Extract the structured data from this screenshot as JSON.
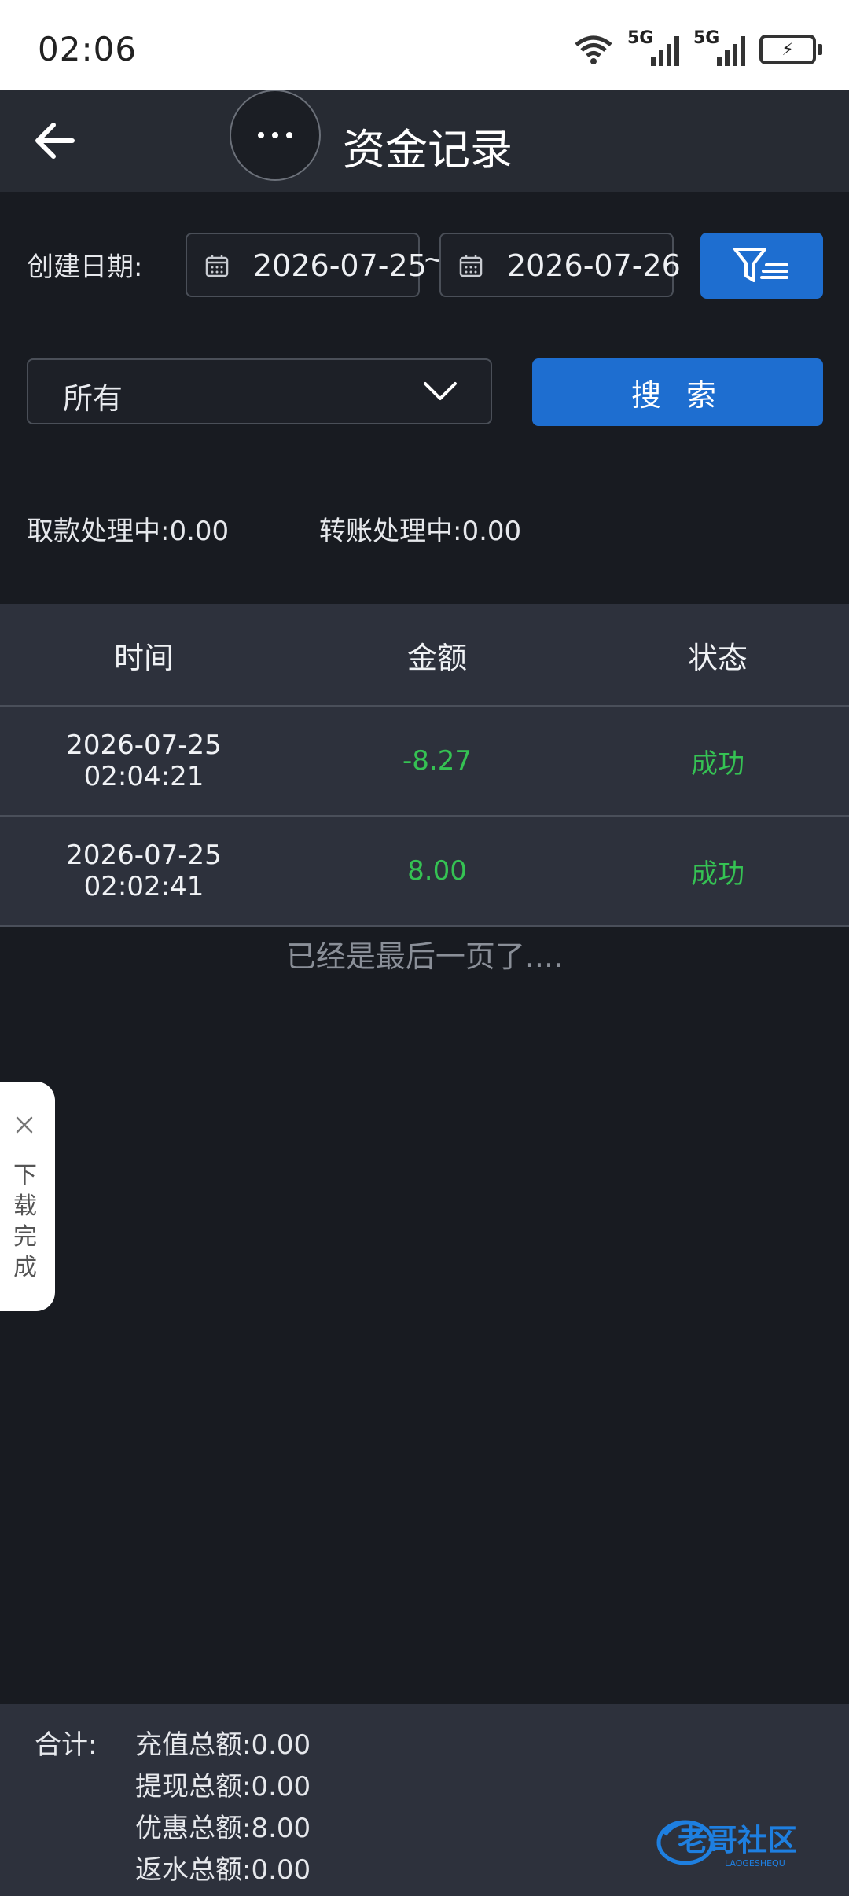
{
  "status_bar": {
    "time": "02:06",
    "network_label_1": "5G",
    "network_label_2": "5G",
    "icons": [
      "wifi-icon",
      "signal-icon",
      "signal-icon",
      "battery-charging-icon"
    ]
  },
  "header": {
    "title": "资金记录",
    "icons": [
      "back-arrow-icon",
      "more-icon"
    ]
  },
  "filters": {
    "date_label": "创建日期:",
    "start_date": "2026-07-25",
    "separator": "~",
    "end_date": "2026-07-26",
    "type_select": "所有",
    "search_label": "搜 索",
    "icons": [
      "calendar-icon",
      "filter-icon",
      "chevron-down-icon"
    ]
  },
  "pending": {
    "withdraw_label": "取款处理中:",
    "withdraw_value": "0.00",
    "transfer_label": "转账处理中:",
    "transfer_value": "0.00"
  },
  "table": {
    "headers": [
      "时间",
      "金额",
      "状态"
    ],
    "rows": [
      {
        "date": "2026-07-25",
        "time": "02:04:21",
        "amount": "-8.27",
        "status": "成功"
      },
      {
        "date": "2026-07-25",
        "time": "02:02:41",
        "amount": "8.00",
        "status": "成功"
      }
    ],
    "end_text": "已经是最后一页了...."
  },
  "download_tab": {
    "text": "下载完成"
  },
  "footer": {
    "total_label": "合计:",
    "items": [
      {
        "label": "充值总额:",
        "value": "0.00"
      },
      {
        "label": "提现总额:",
        "value": "0.00"
      },
      {
        "label": "优惠总额:",
        "value": "8.00"
      },
      {
        "label": "返水总额:",
        "value": "0.00"
      }
    ],
    "watermark": "老哥社区",
    "watermark_sub": "LAOGESHEQU"
  },
  "colors": {
    "accent": "#1e6ed0",
    "success": "#35c253",
    "background": "#181b21"
  }
}
